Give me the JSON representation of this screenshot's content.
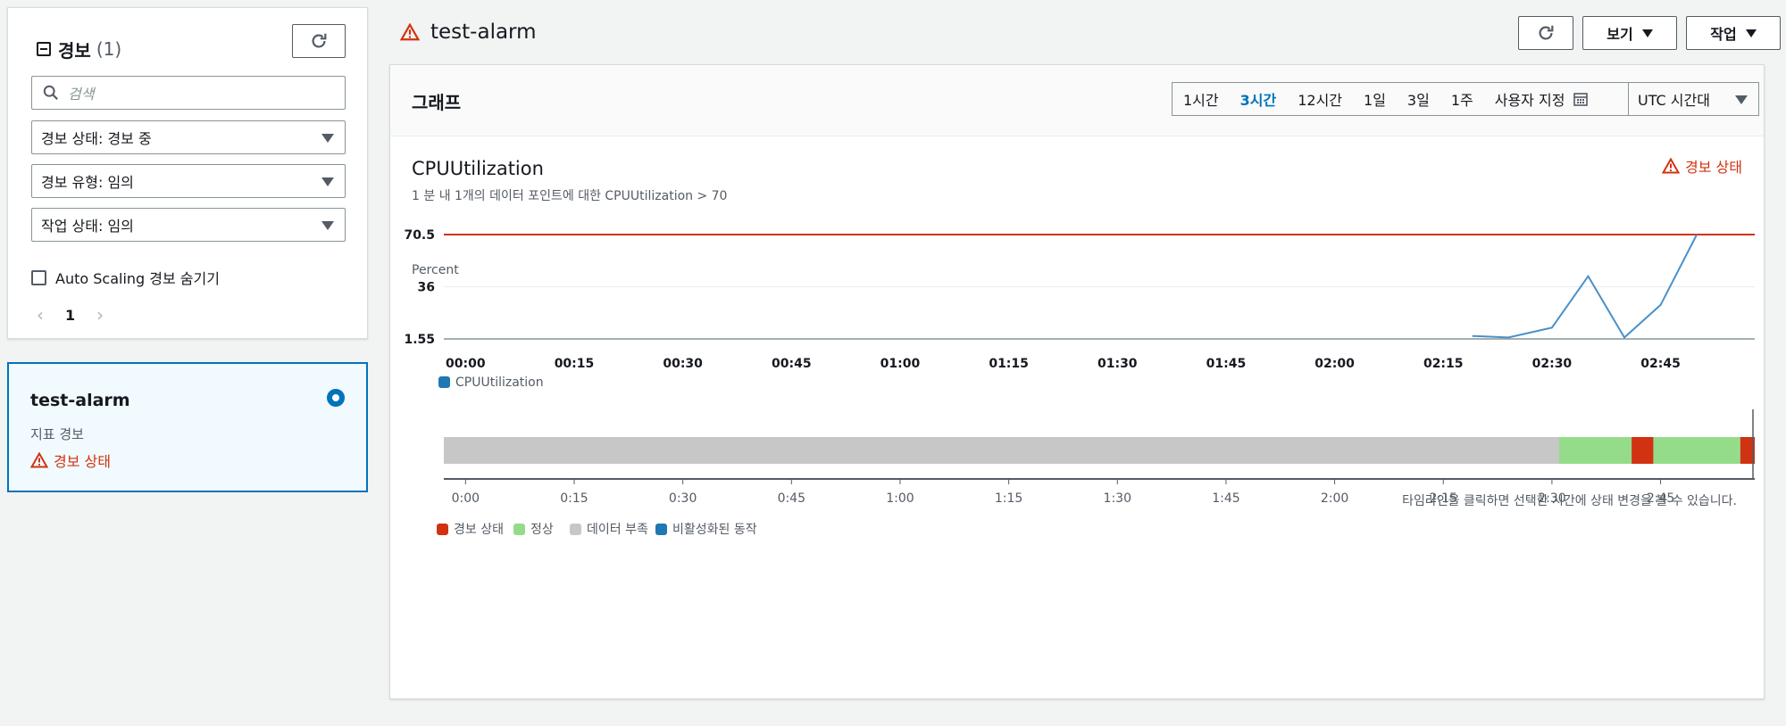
{
  "sidebar": {
    "header_title": "경보",
    "header_count": "(1)",
    "search_placeholder": "검색",
    "filters": [
      {
        "label": "경보 상태: 경보 중"
      },
      {
        "label": "경보 유형: 임의"
      },
      {
        "label": "작업 상태: 임의"
      }
    ],
    "hide_autoscaling_label": "Auto Scaling 경보 숨기기",
    "page_number": "1"
  },
  "alarm_list": [
    {
      "name": "test-alarm",
      "kind": "지표 경보",
      "state": "경보 상태"
    }
  ],
  "header": {
    "title": "test-alarm",
    "view_label": "보기",
    "action_label": "작업"
  },
  "graph": {
    "panel_title": "그래프",
    "ranges": [
      "1시간",
      "3시간",
      "12시간",
      "1일",
      "3일",
      "1주"
    ],
    "active_range": "3시간",
    "custom_label": "사용자 지정",
    "timezone": "UTC 시간대",
    "metric_title": "CPUUtilization",
    "metric_subtitle": "1 분 내 1개의 데이터 포인트에 대한 CPUUtilization > 70",
    "alarm_state_label": "경보 상태",
    "timeline_hint": "타임라인을 클릭하면 선택한 시간에 상태 변경을 볼 수 있습니다."
  },
  "colors": {
    "alarm": "#d13212",
    "ok": "#95dc8a",
    "insufficient": "#c7c7c7",
    "disabled": "#1f77b4",
    "series": "#4a90c8",
    "threshold": "#d13212"
  },
  "chart_data": {
    "type": "line",
    "ylabel": "Percent",
    "yticks": [
      1.55,
      36,
      70.5
    ],
    "ylim": [
      1.55,
      70.5
    ],
    "xticks": [
      "00:00",
      "00:15",
      "00:30",
      "00:45",
      "01:00",
      "01:15",
      "01:30",
      "01:45",
      "02:00",
      "02:15",
      "02:30",
      "02:45"
    ],
    "xlim_minutes": [
      -3,
      178
    ],
    "threshold": 70.5,
    "series": [
      {
        "name": "CPUUtilization",
        "x_minutes": [
          139,
          144,
          150,
          155,
          160,
          165,
          170
        ],
        "y": [
          3.5,
          2.5,
          9,
          43,
          2.5,
          24,
          70.5
        ]
      }
    ],
    "timeline": {
      "xticks": [
        "0:00",
        "0:15",
        "0:30",
        "0:45",
        "1:00",
        "1:15",
        "1:30",
        "1:45",
        "2:00",
        "2:15",
        "2:30",
        "2:45"
      ],
      "segments": [
        {
          "state": "insufficient",
          "start": -3,
          "end": 151
        },
        {
          "state": "ok",
          "start": 151,
          "end": 161
        },
        {
          "state": "alarm",
          "start": 161,
          "end": 164
        },
        {
          "state": "ok",
          "start": 164,
          "end": 176
        },
        {
          "state": "alarm",
          "start": 176,
          "end": 178
        }
      ],
      "legend": [
        {
          "state": "alarm",
          "label": "경보 상태"
        },
        {
          "state": "ok",
          "label": "정상"
        },
        {
          "state": "insufficient",
          "label": "데이터 부족"
        },
        {
          "state": "disabled",
          "label": "비활성화된 동작"
        }
      ]
    }
  }
}
